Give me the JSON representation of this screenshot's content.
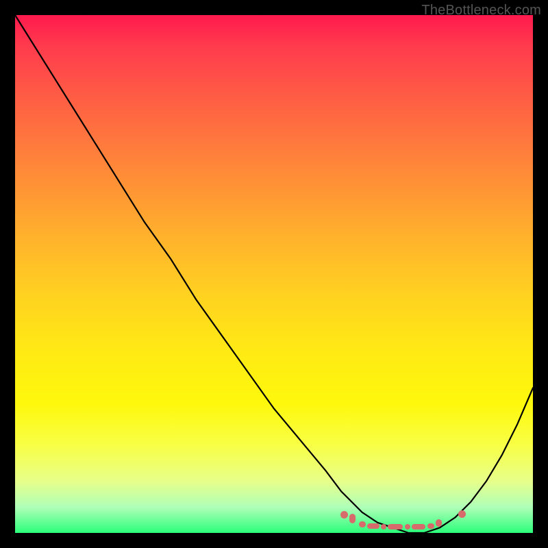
{
  "watermark": "TheBottleneck.com",
  "chart_data": {
    "type": "line",
    "title": "",
    "xlabel": "",
    "ylabel": "",
    "xlim": [
      0,
      100
    ],
    "ylim": [
      0,
      100
    ],
    "grid": false,
    "legend": false,
    "series": [
      {
        "name": "bottleneck-curve",
        "x": [
          0,
          5,
          10,
          15,
          20,
          25,
          30,
          35,
          40,
          45,
          50,
          55,
          60,
          63,
          67,
          70,
          73,
          76,
          79,
          82,
          85,
          88,
          91,
          94,
          97,
          100
        ],
        "y": [
          100,
          92,
          84,
          76,
          68,
          60,
          53,
          45,
          38,
          31,
          24,
          18,
          12,
          8,
          4,
          2,
          1,
          0,
          0,
          1,
          3,
          6,
          10,
          15,
          21,
          28
        ]
      }
    ],
    "optimal_cluster_x_range": [
      63,
      85
    ],
    "background_gradient": {
      "top": "#ff1a4d",
      "middle": "#ffe414",
      "bottom": "#2bff7a"
    },
    "annotation_color": "#d76b6b"
  }
}
